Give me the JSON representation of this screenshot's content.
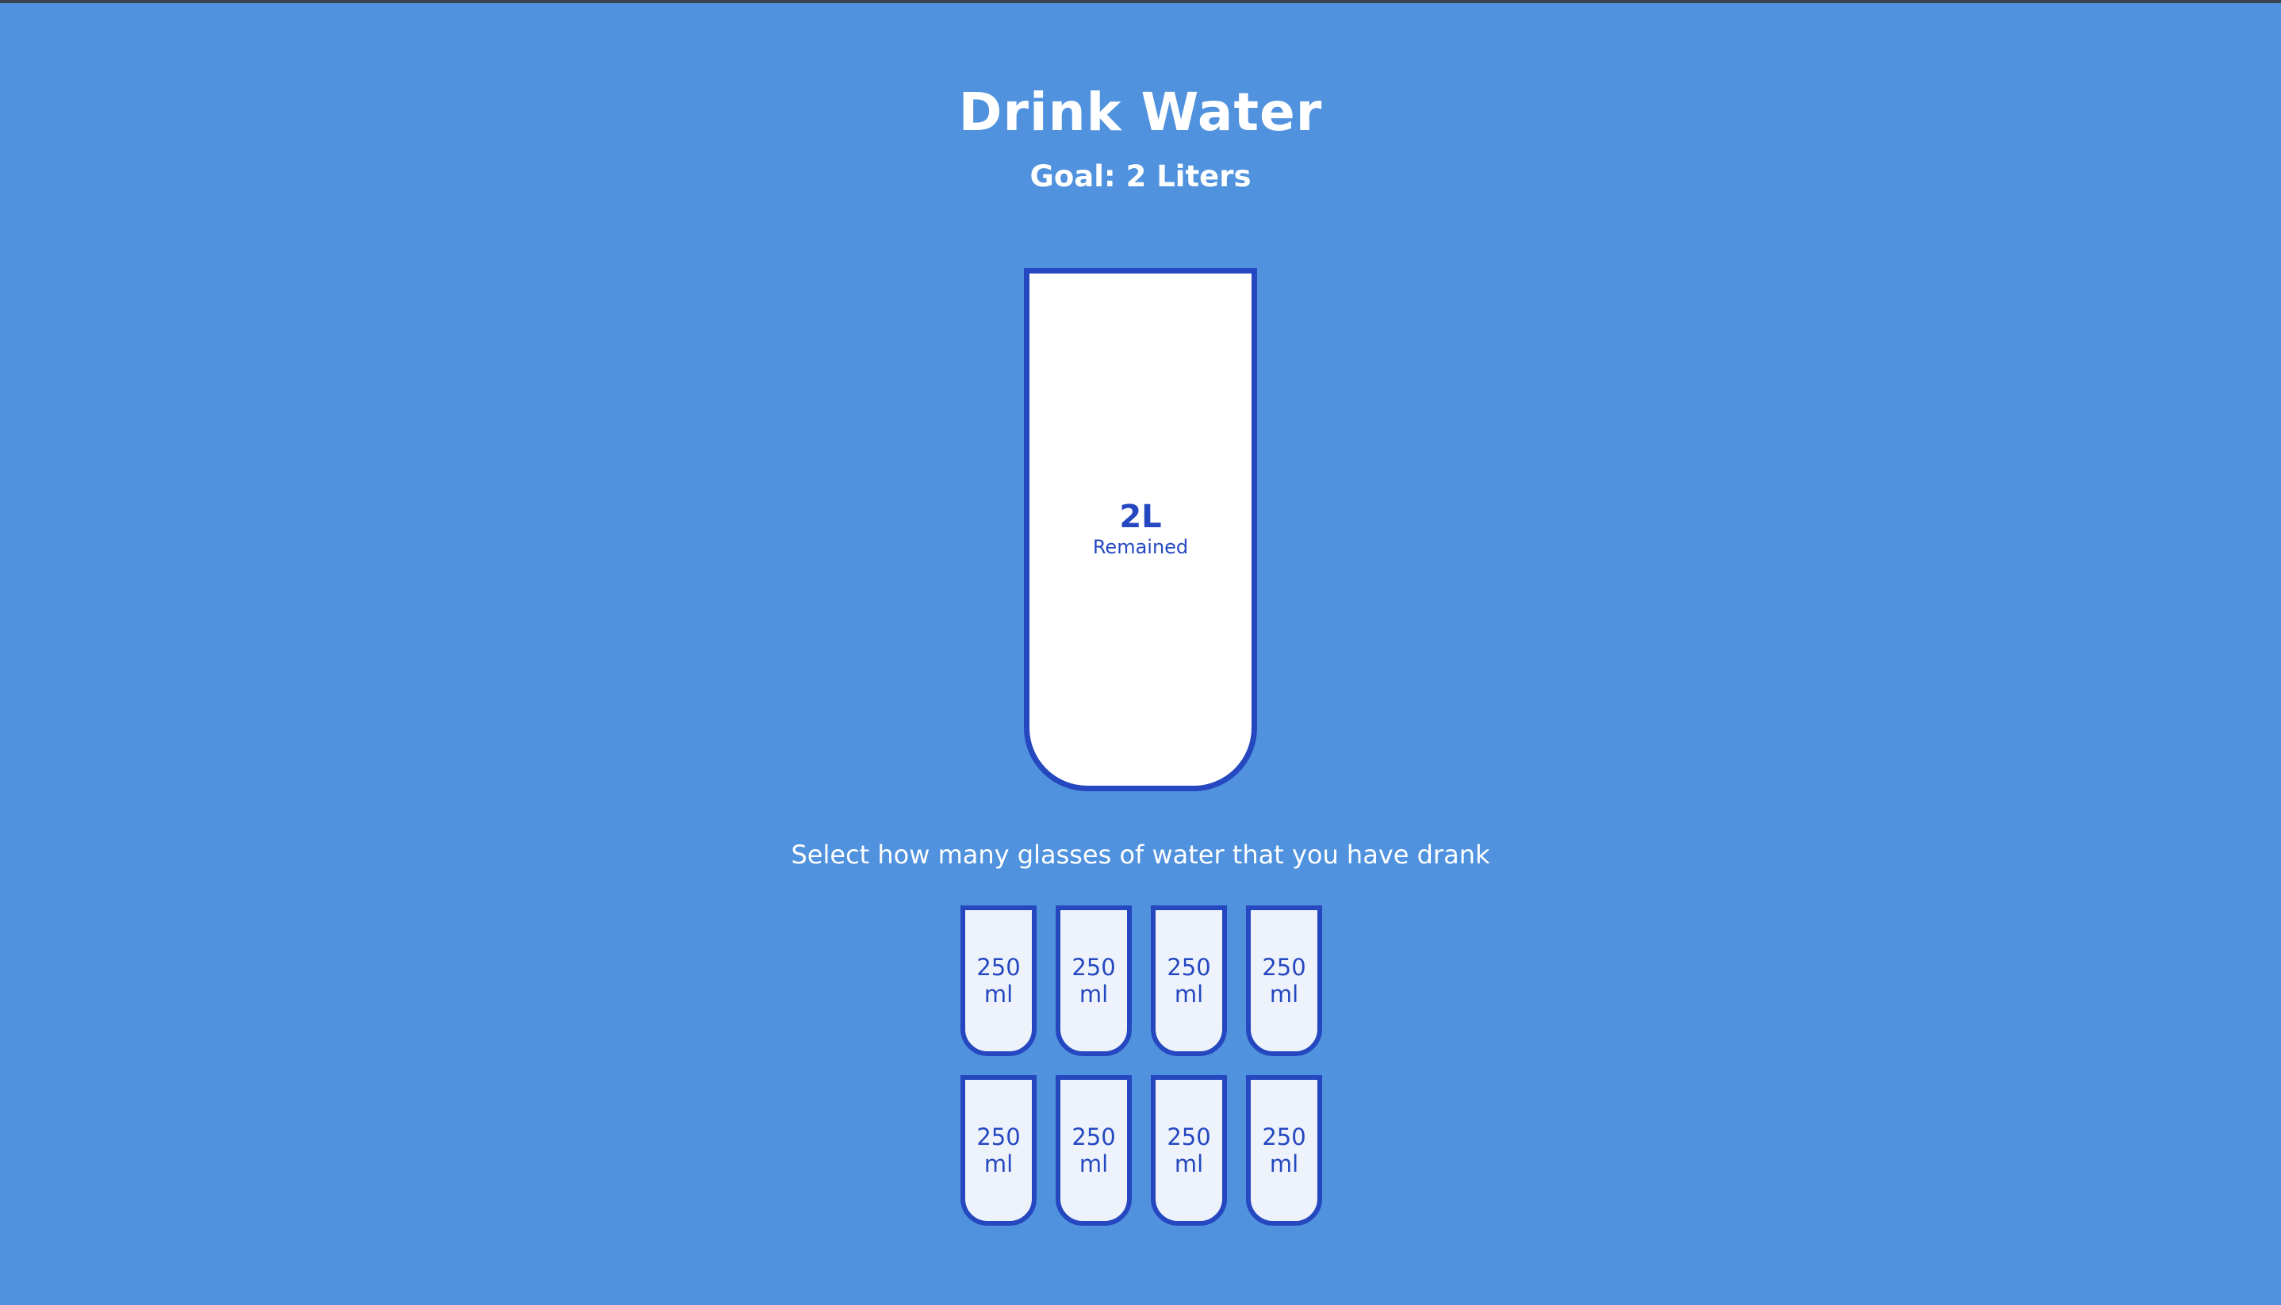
{
  "header": {
    "title": "Drink Water",
    "goal": "Goal: 2 Liters"
  },
  "big_cup": {
    "remained_amount": "2L",
    "remained_label": "Remained",
    "filled_fraction": 0
  },
  "instruction": "Select how many glasses of water that you have drank",
  "cups": [
    {
      "amount": "250",
      "unit": "ml",
      "selected": false
    },
    {
      "amount": "250",
      "unit": "ml",
      "selected": false
    },
    {
      "amount": "250",
      "unit": "ml",
      "selected": false
    },
    {
      "amount": "250",
      "unit": "ml",
      "selected": false
    },
    {
      "amount": "250",
      "unit": "ml",
      "selected": false
    },
    {
      "amount": "250",
      "unit": "ml",
      "selected": false
    },
    {
      "amount": "250",
      "unit": "ml",
      "selected": false
    },
    {
      "amount": "250",
      "unit": "ml",
      "selected": false
    }
  ],
  "colors": {
    "background": "#5092de",
    "accent": "#2548c0",
    "cup_fill": "#ffffff",
    "small_cup_fill": "#eef3fb"
  }
}
